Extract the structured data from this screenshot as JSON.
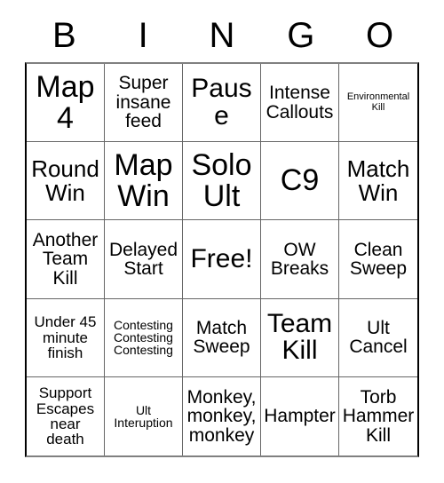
{
  "card": {
    "title": "BINGO",
    "headers": [
      {
        "label": "B"
      },
      {
        "label": "I"
      },
      {
        "label": "N"
      },
      {
        "label": "G"
      },
      {
        "label": "O"
      }
    ],
    "free_space_label": "Free!",
    "colors": {
      "background": "#ffffff",
      "text": "#000000",
      "grid_line": "#666666",
      "border": "#000000"
    },
    "rows": 5,
    "columns": 5,
    "cells": [
      {
        "text": "Map\n4",
        "size": "xxl",
        "free": false
      },
      {
        "text": "Super\ninsane\nfeed",
        "size": "md",
        "free": false
      },
      {
        "text": "Pause",
        "size": "xl",
        "free": false
      },
      {
        "text": "Intense\nCallouts",
        "size": "md",
        "free": false
      },
      {
        "text": "Environmental\nKill",
        "size": "xxs",
        "free": false
      },
      {
        "text": "Round\nWin",
        "size": "lg",
        "free": false
      },
      {
        "text": "Map\nWin",
        "size": "xxl",
        "free": false
      },
      {
        "text": "Solo\nUlt",
        "size": "xxl",
        "free": false
      },
      {
        "text": "C9",
        "size": "xxl",
        "free": false
      },
      {
        "text": "Match\nWin",
        "size": "lg",
        "free": false
      },
      {
        "text": "Another\nTeam\nKill",
        "size": "md",
        "free": false
      },
      {
        "text": "Delayed\nStart",
        "size": "md",
        "free": false
      },
      {
        "text": "Free!",
        "size": "xl",
        "free": true
      },
      {
        "text": "OW\nBreaks",
        "size": "md",
        "free": false
      },
      {
        "text": "Clean\nSweep",
        "size": "md",
        "free": false
      },
      {
        "text": "Under 45\nminute\nfinish",
        "size": "sm",
        "free": false
      },
      {
        "text": "Contesting\nContesting\nContesting",
        "size": "xs",
        "free": false
      },
      {
        "text": "Match\nSweep",
        "size": "md",
        "free": false
      },
      {
        "text": "Team\nKill",
        "size": "xl",
        "free": false
      },
      {
        "text": "Ult\nCancel",
        "size": "md",
        "free": false
      },
      {
        "text": "Support\nEscapes\nnear\ndeath",
        "size": "sm",
        "free": false
      },
      {
        "text": "Ult\nInteruption",
        "size": "xs",
        "free": false
      },
      {
        "text": "Monkey,\nmonkey,\nmonkey",
        "size": "md",
        "free": false
      },
      {
        "text": "Hampter",
        "size": "md",
        "free": false
      },
      {
        "text": "Torb\nHammer\nKill",
        "size": "md",
        "free": false
      }
    ]
  }
}
